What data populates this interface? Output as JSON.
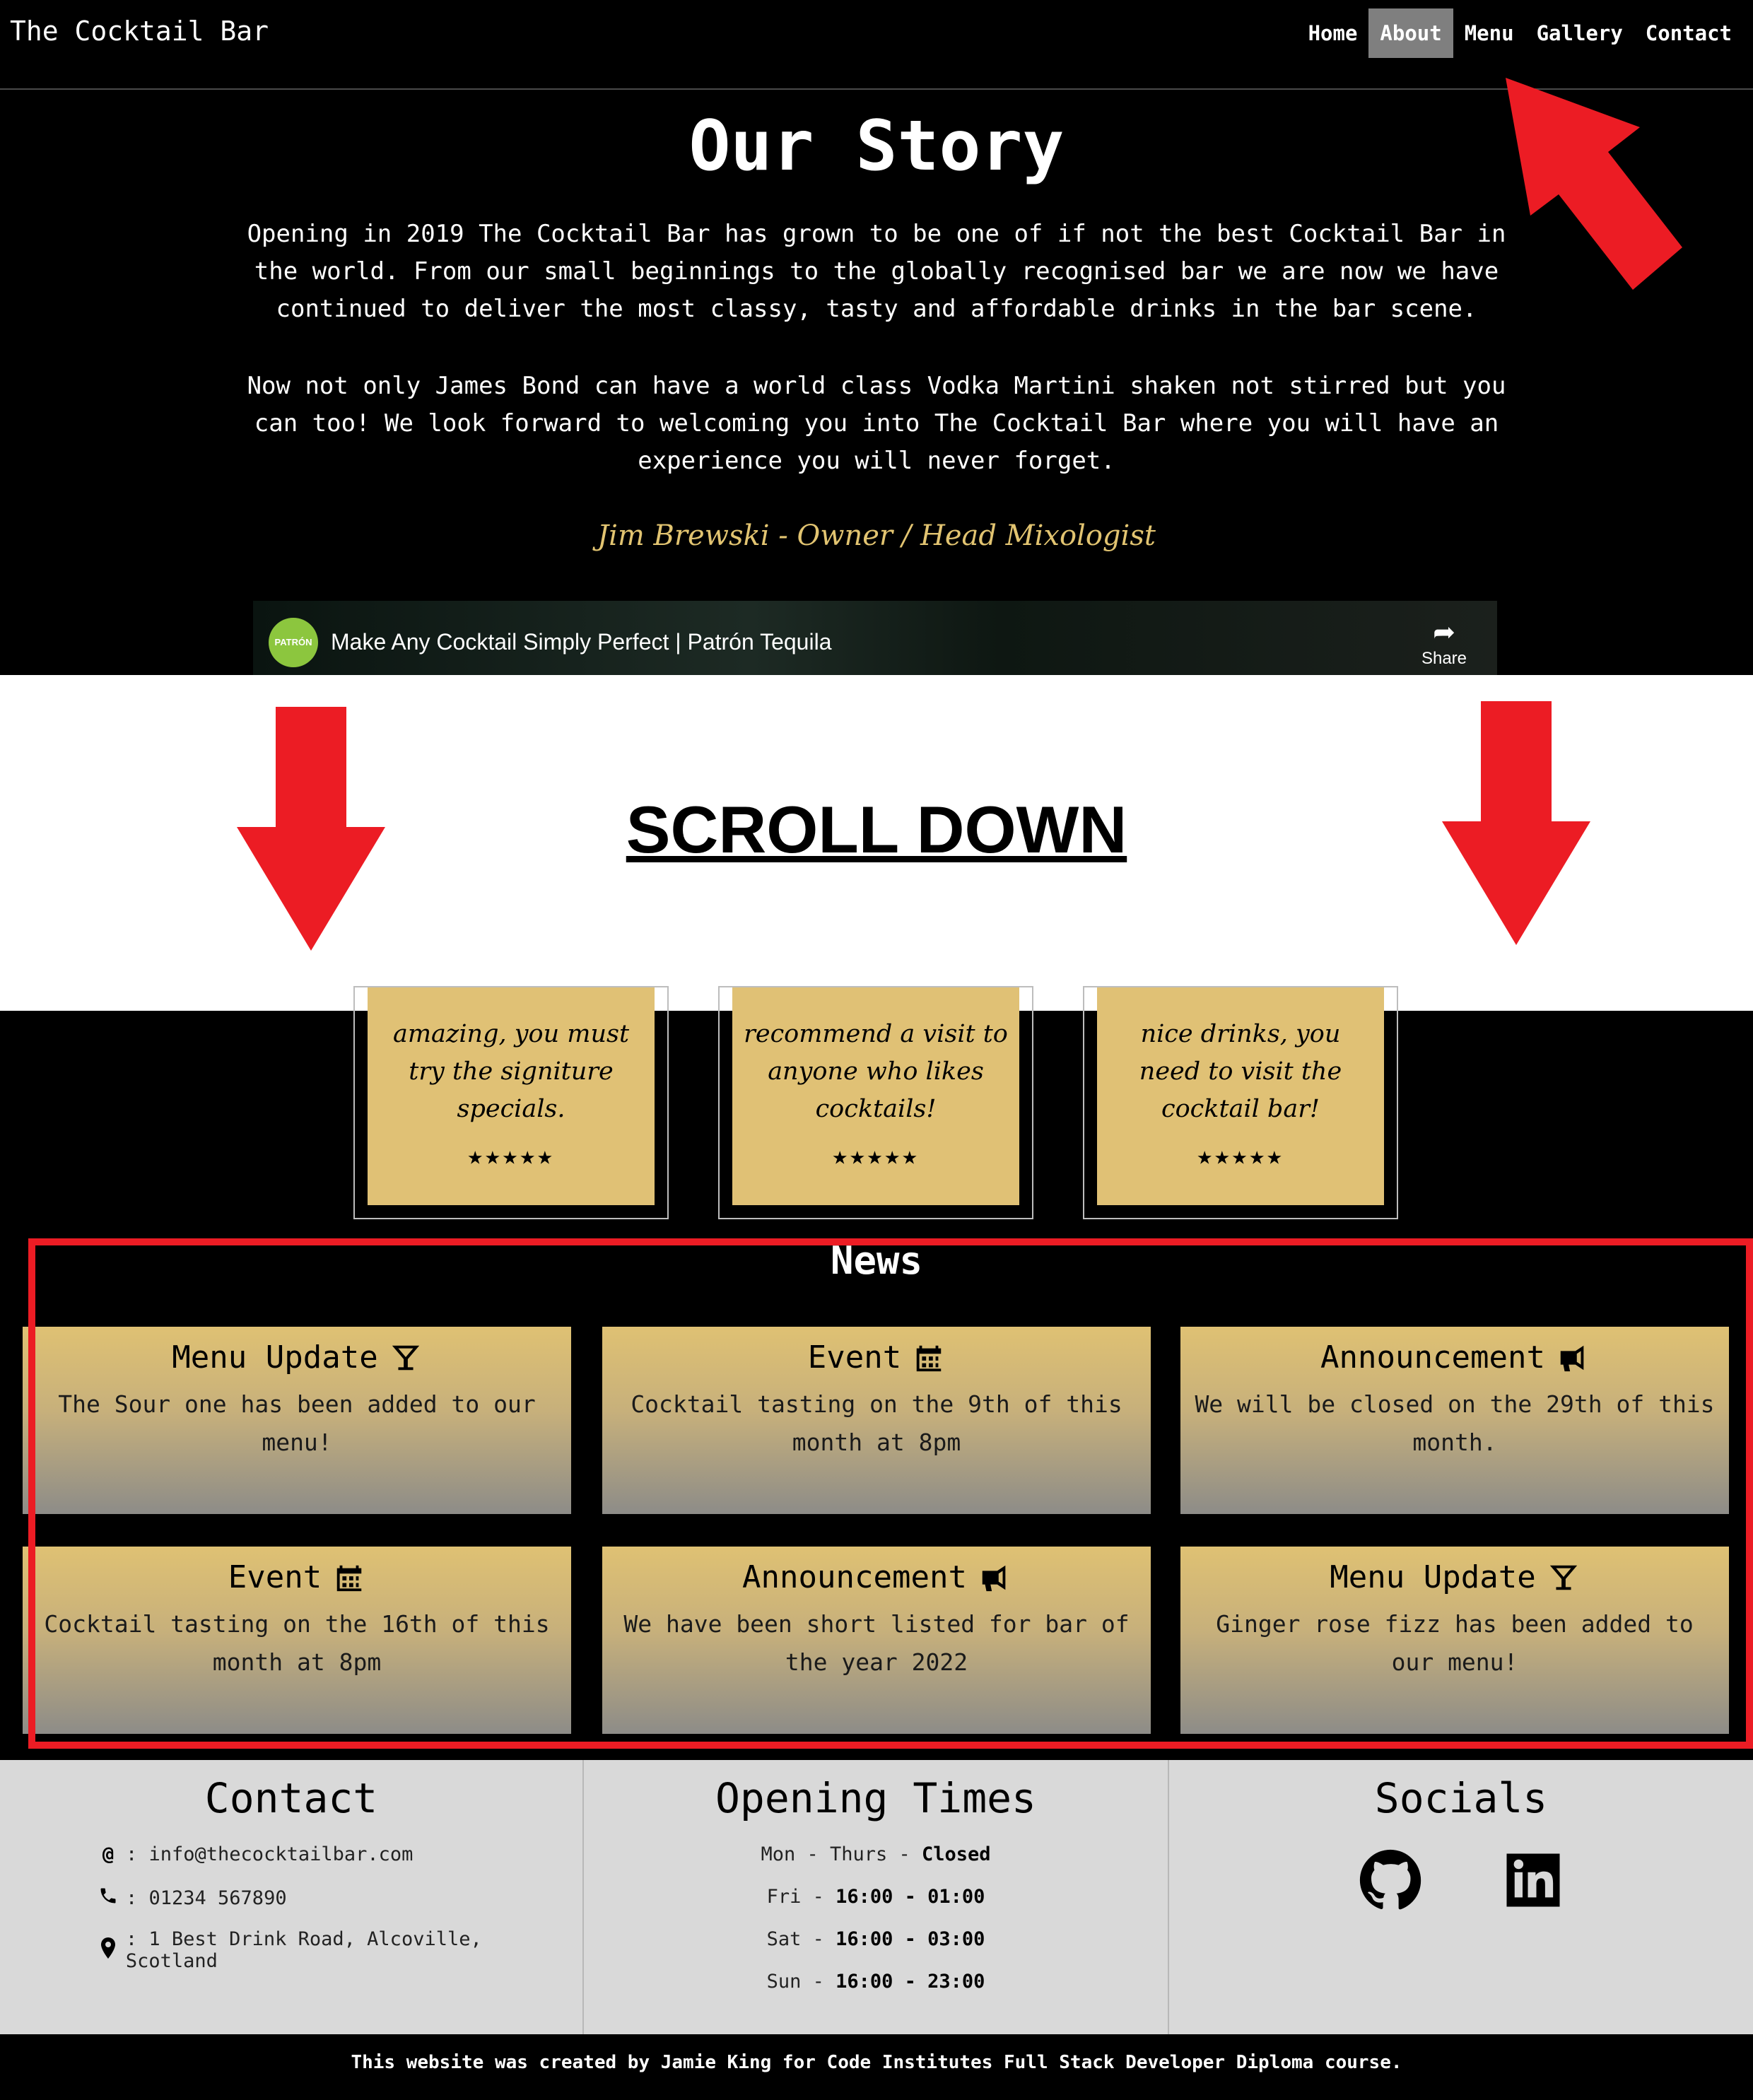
{
  "navbar": {
    "brand": "The Cocktail Bar",
    "links": [
      {
        "label": "Home",
        "active": false
      },
      {
        "label": "About",
        "active": true
      },
      {
        "label": "Menu",
        "active": false
      },
      {
        "label": "Gallery",
        "active": false
      },
      {
        "label": "Contact",
        "active": false
      }
    ]
  },
  "story": {
    "title": "Our Story",
    "paragraph1": "Opening in 2019 The Cocktail Bar has grown to be one of if not the best Cocktail Bar in the world. From our small beginnings to the globally recognised bar we are now we have continued to deliver the most classy, tasty and affordable drinks in the bar scene.",
    "paragraph2": "Now not only James Bond can have a world class Vodka Martini shaken not stirred but you can too! We look forward to welcoming you into The Cocktail Bar where you will have an experience you will never forget.",
    "signature": "Jim Brewski - Owner / Head Mixologist"
  },
  "video": {
    "channel_logo_text": "PATRÓN",
    "title": "Make Any Cocktail Simply Perfect | Patrón Tequila",
    "share_label": "Share"
  },
  "annotation": {
    "scroll_text": "SCROLL DOWN",
    "color": "#ec1c24"
  },
  "reviews": [
    {
      "text": "amazing, you must try the signiture specials.",
      "stars": "★★★★★"
    },
    {
      "text": "recommend a visit to anyone who likes cocktails!",
      "stars": "★★★★★"
    },
    {
      "text": "nice drinks, you need to visit the cocktail bar!",
      "stars": "★★★★★"
    }
  ],
  "news": {
    "title": "News",
    "items": [
      {
        "heading": "Menu Update",
        "icon": "cocktail-glass-icon",
        "body": "The Sour one has been added to our menu!"
      },
      {
        "heading": "Event",
        "icon": "calendar-icon",
        "body": "Cocktail tasting on the 9th of this month at 8pm"
      },
      {
        "heading": "Announcement",
        "icon": "megaphone-icon",
        "body": "We will be closed on the 29th of this month."
      },
      {
        "heading": "Event",
        "icon": "calendar-icon",
        "body": "Cocktail tasting on the 16th of this month at 8pm"
      },
      {
        "heading": "Announcement",
        "icon": "megaphone-icon",
        "body": "We have been short listed for bar of the year 2022"
      },
      {
        "heading": "Menu Update",
        "icon": "cocktail-glass-icon",
        "body": "Ginger rose fizz has been added to our menu!"
      }
    ]
  },
  "footer": {
    "contact": {
      "heading": "Contact",
      "email": ": info@thecocktailbar.com",
      "phone": ": 01234 567890",
      "address": ": 1 Best Drink Road, Alcoville, Scotland"
    },
    "opening": {
      "heading": "Opening Times",
      "rows": [
        {
          "day": "Mon - Thurs - ",
          "time": "Closed"
        },
        {
          "day": "Fri - ",
          "time": "16:00 - 01:00"
        },
        {
          "day": "Sat - ",
          "time": "16:00 - 03:00"
        },
        {
          "day": "Sun - ",
          "time": "16:00 - 23:00"
        }
      ]
    },
    "socials": {
      "heading": "Socials",
      "icons": [
        "github-icon",
        "linkedin-icon"
      ]
    },
    "credit": "This website was created by Jamie King for Code Institutes Full Stack Developer Diploma course."
  }
}
